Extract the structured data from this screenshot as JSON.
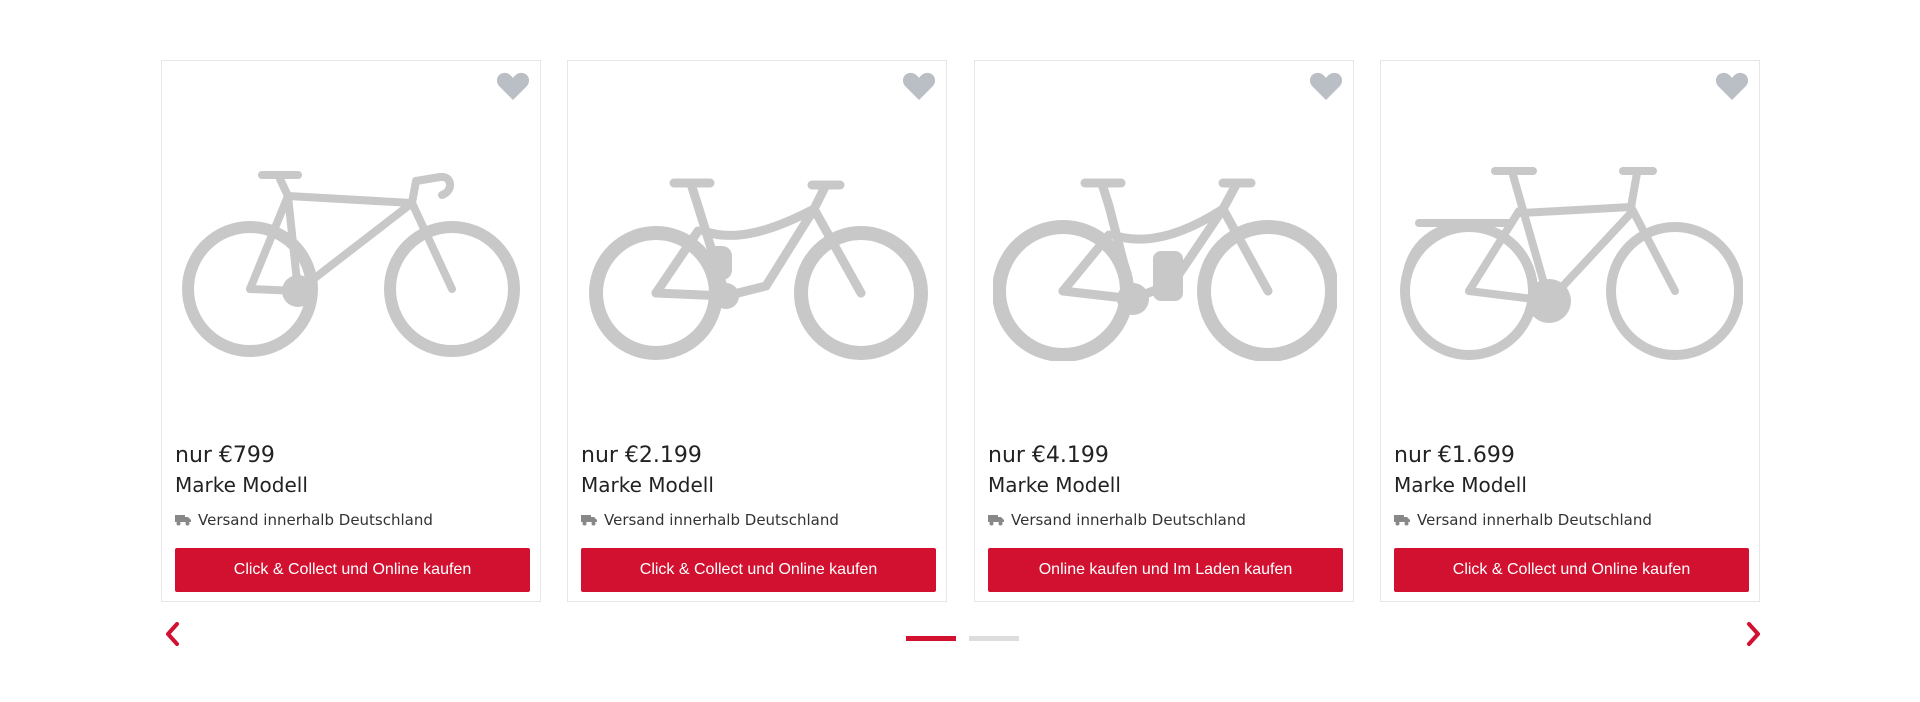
{
  "colors": {
    "accent": "#d2102f",
    "heart": "#b9bfc4",
    "bike": "#c8c8c8",
    "dot_inactive": "#dddddd"
  },
  "products": [
    {
      "price": "nur €799",
      "model": "Marke Modell",
      "shipping": "Versand innerhalb Deutschland",
      "button": "Click & Collect und Online kaufen",
      "bike_type": "road-bike",
      "icon": "heart-icon"
    },
    {
      "price": "nur €2.199",
      "model": "Marke Modell",
      "shipping": "Versand innerhalb Deutschland",
      "button": "Click & Collect und Online kaufen",
      "bike_type": "mountain-bike",
      "icon": "heart-icon"
    },
    {
      "price": "nur €4.199",
      "model": "Marke Modell",
      "shipping": "Versand innerhalb Deutschland",
      "button": "Online kaufen und Im Laden kaufen",
      "bike_type": "e-mountain-bike",
      "icon": "heart-icon"
    },
    {
      "price": "nur €1.699",
      "model": "Marke Modell",
      "shipping": "Versand innerhalb Deutschland",
      "button": "Click & Collect und Online kaufen",
      "bike_type": "trekking-bike",
      "icon": "heart-icon"
    }
  ],
  "navigation": {
    "prev_icon": "chevron-left-icon",
    "next_icon": "chevron-right-icon",
    "pages": 2,
    "active_page": 1
  }
}
